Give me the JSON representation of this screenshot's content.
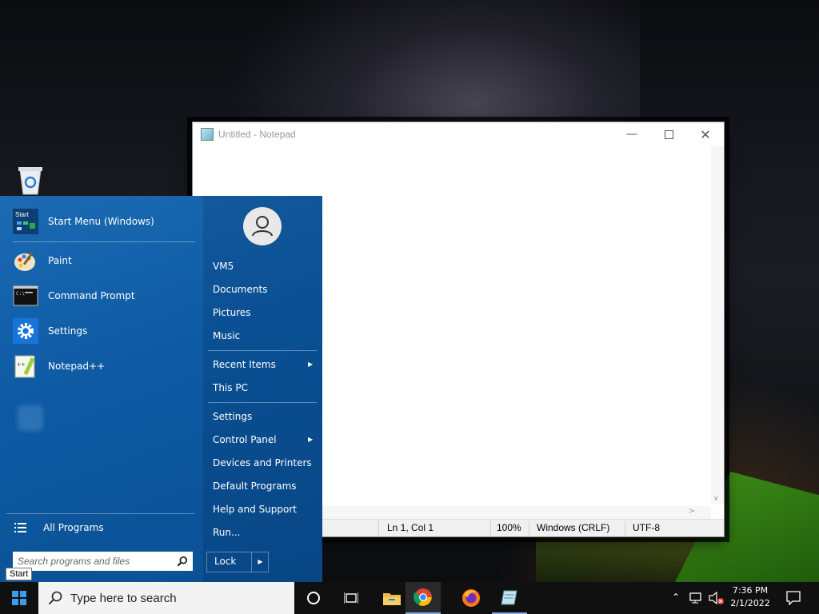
{
  "notepad": {
    "title": "Untitled - Notepad",
    "status": {
      "position": "Ln 1, Col 1",
      "zoom": "100%",
      "line_ending": "Windows (CRLF)",
      "encoding": "UTF-8"
    }
  },
  "start_menu": {
    "pinned": [
      {
        "label": "Start Menu (Windows)",
        "icon": "start-menu-icon"
      },
      {
        "label": "Paint",
        "icon": "paint-icon"
      },
      {
        "label": "Command Prompt",
        "icon": "command-prompt-icon"
      },
      {
        "label": "Settings",
        "icon": "settings-gear-icon"
      },
      {
        "label": "Notepad++",
        "icon": "notepad-plus-plus-icon"
      }
    ],
    "start_icon_text": "Start",
    "all_programs": "All Programs",
    "search_placeholder": "Search programs and files",
    "right": {
      "user": "VM5",
      "documents": "Documents",
      "pictures": "Pictures",
      "music": "Music",
      "recent_items": "Recent Items",
      "this_pc": "This PC",
      "settings": "Settings",
      "control_panel": "Control Panel",
      "devices_printers": "Devices and Printers",
      "default_programs": "Default Programs",
      "help_support": "Help and Support",
      "run": "Run..."
    },
    "lock": "Lock",
    "tooltip": "Start"
  },
  "taskbar": {
    "search_placeholder": "Type here to search",
    "time": "7:36 PM",
    "date": "2/1/2022"
  },
  "colors": {
    "start_menu_bg": "#1060aa",
    "taskbar_bg": "#101010"
  }
}
